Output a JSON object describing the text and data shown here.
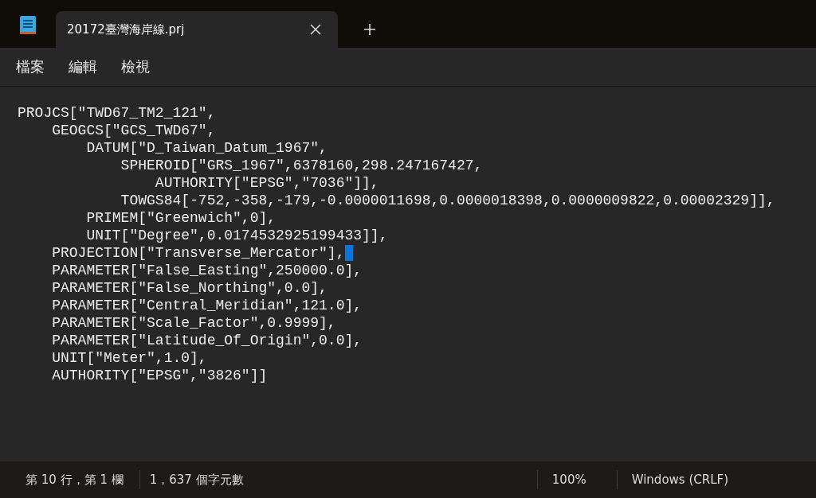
{
  "tabs": [
    {
      "label": "20172臺灣海岸線.prj",
      "selected": true
    }
  ],
  "menu": [
    "檔案",
    "編輯",
    "檢視"
  ],
  "lines": [
    {
      "text": "PROJCS[\"TWD67_TM2_121\",",
      "caret": false
    },
    {
      "text": "    GEOGCS[\"GCS_TWD67\",",
      "caret": false
    },
    {
      "text": "        DATUM[\"D_Taiwan_Datum_1967\",",
      "caret": false
    },
    {
      "text": "            SPHEROID[\"GRS_1967\",6378160,298.247167427,",
      "caret": false
    },
    {
      "text": "                AUTHORITY[\"EPSG\",\"7036\"]],",
      "caret": false
    },
    {
      "text": "            TOWGS84[-752,-358,-179,-0.0000011698,0.0000018398,0.0000009822,0.00002329]],",
      "caret": false
    },
    {
      "text": "        PRIMEM[\"Greenwich\",0],",
      "caret": false
    },
    {
      "text": "        UNIT[\"Degree\",0.0174532925199433]],",
      "caret": false
    },
    {
      "text": "    PROJECTION[\"Transverse_Mercator\"],",
      "caret": true
    },
    {
      "text": "    PARAMETER[\"False_Easting\",250000.0],",
      "caret": false
    },
    {
      "text": "    PARAMETER[\"False_Northing\",0.0],",
      "caret": false
    },
    {
      "text": "    PARAMETER[\"Central_Meridian\",121.0],",
      "caret": false
    },
    {
      "text": "    PARAMETER[\"Scale_Factor\",0.9999],",
      "caret": false
    },
    {
      "text": "    PARAMETER[\"Latitude_Of_Origin\",0.0],",
      "caret": false
    },
    {
      "text": "    UNIT[\"Meter\",1.0],",
      "caret": false
    },
    {
      "text": "    AUTHORITY[\"EPSG\",\"3826\"]]",
      "caret": false
    }
  ],
  "status_bar": {
    "position": "第 10 行，第 1 欄",
    "characters": "1，637 個字元數",
    "zoom": "100%",
    "line_ending": "Windows (CRLF)"
  }
}
